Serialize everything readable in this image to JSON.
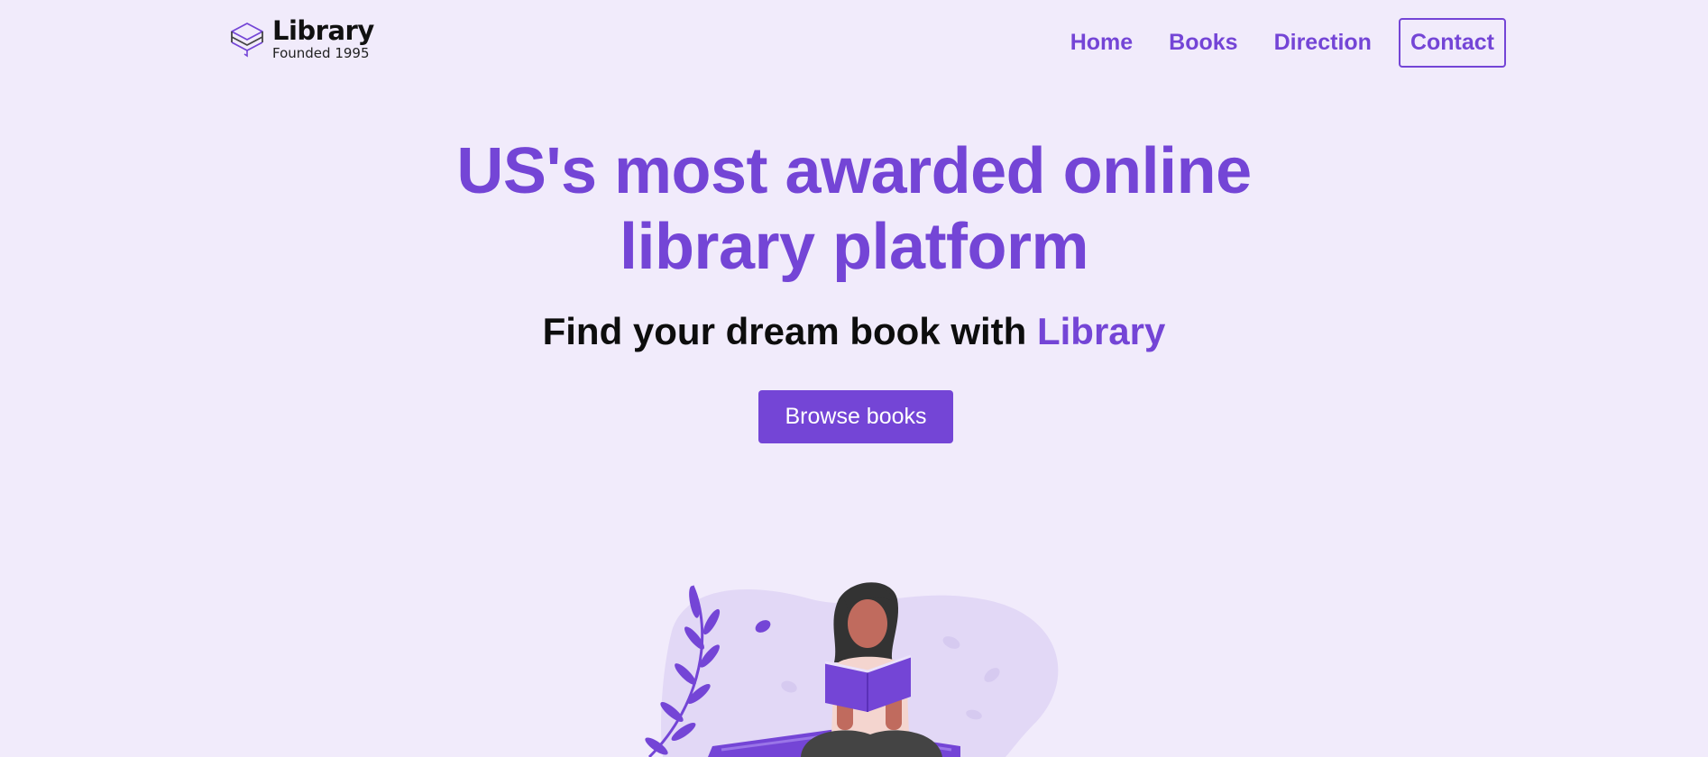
{
  "brand": {
    "name": "Library",
    "tagline": "Founded 1995",
    "icon": "books-stack-icon"
  },
  "nav": {
    "items": [
      {
        "label": "Home"
      },
      {
        "label": "Books"
      },
      {
        "label": "Direction"
      },
      {
        "label": "Contact"
      }
    ]
  },
  "hero": {
    "title_line1": "US's most awarded online",
    "title_line2": "library platform",
    "subtitle_prefix": "Find your dream book with",
    "subtitle_accent": "Library",
    "cta_label": "Browse books"
  },
  "illustration": {
    "name": "woman-reading-book-illustration"
  },
  "colors": {
    "background": "#f1ebfb",
    "accent": "#7445d6",
    "text": "#0d0d0d",
    "blob": "#e2d8f6"
  }
}
